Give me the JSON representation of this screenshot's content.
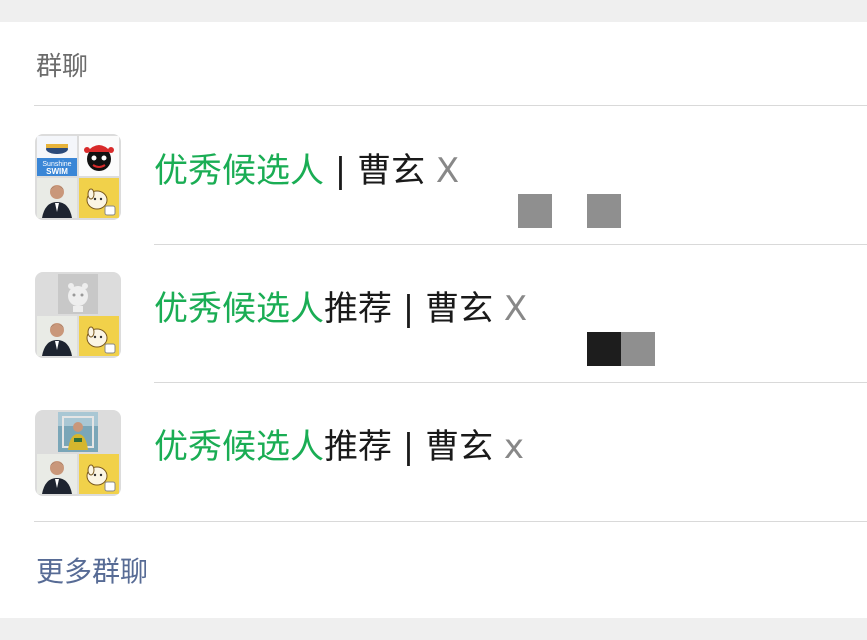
{
  "section": {
    "title": "群聊",
    "more_label": "更多群聊"
  },
  "groups": [
    {
      "highlight": "优秀候选人",
      "rest": " | 曹玄",
      "tail": " X"
    },
    {
      "highlight": "优秀候选人",
      "rest": "推荐 | 曹玄",
      "tail": " X"
    },
    {
      "highlight": "优秀候选人",
      "rest": "推荐 | 曹玄",
      "tail": " x"
    }
  ],
  "avatar_tiles": {
    "swim_logo_text": "SWIM",
    "swim_logo_subtext": "Sunshine"
  },
  "colors": {
    "highlight": "#1aad54",
    "link": "#576b95",
    "text": "#1a1a1a",
    "muted": "#6b6b6b",
    "background": "#efefef",
    "card": "#ffffff"
  }
}
